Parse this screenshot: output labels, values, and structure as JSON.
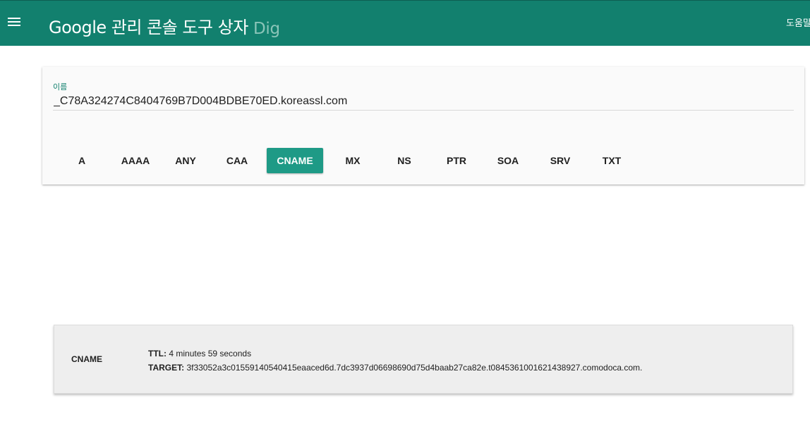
{
  "header": {
    "title": "Google 관리 콘솔 도구 상자",
    "subtitle": "Dig",
    "help_label": "도움말",
    "color": "#12806e"
  },
  "query": {
    "name_label": "이름",
    "name_value": "_C78A324274C8404769B7D004BDBE70ED.koreassl.com",
    "record_types": [
      {
        "label": "A",
        "active": false
      },
      {
        "label": "AAAA",
        "active": false
      },
      {
        "label": "ANY",
        "active": false
      },
      {
        "label": "CAA",
        "active": false
      },
      {
        "label": "CNAME",
        "active": true
      },
      {
        "label": "MX",
        "active": false
      },
      {
        "label": "NS",
        "active": false
      },
      {
        "label": "PTR",
        "active": false
      },
      {
        "label": "SOA",
        "active": false
      },
      {
        "label": "SRV",
        "active": false
      },
      {
        "label": "TXT",
        "active": false
      }
    ],
    "active_color": "#1e9a86"
  },
  "result": {
    "type": "CNAME",
    "ttl_label": "TTL:",
    "ttl_value": "4 minutes 59 seconds",
    "target_label": "TARGET:",
    "target_value": "3f33052a3c01559140540415eaaced6d.7dc3937d06698690d75d4baab27ca82e.t0845361001621438927.comodoca.com."
  },
  "icons": {
    "menu": "hamburger-menu-icon"
  }
}
